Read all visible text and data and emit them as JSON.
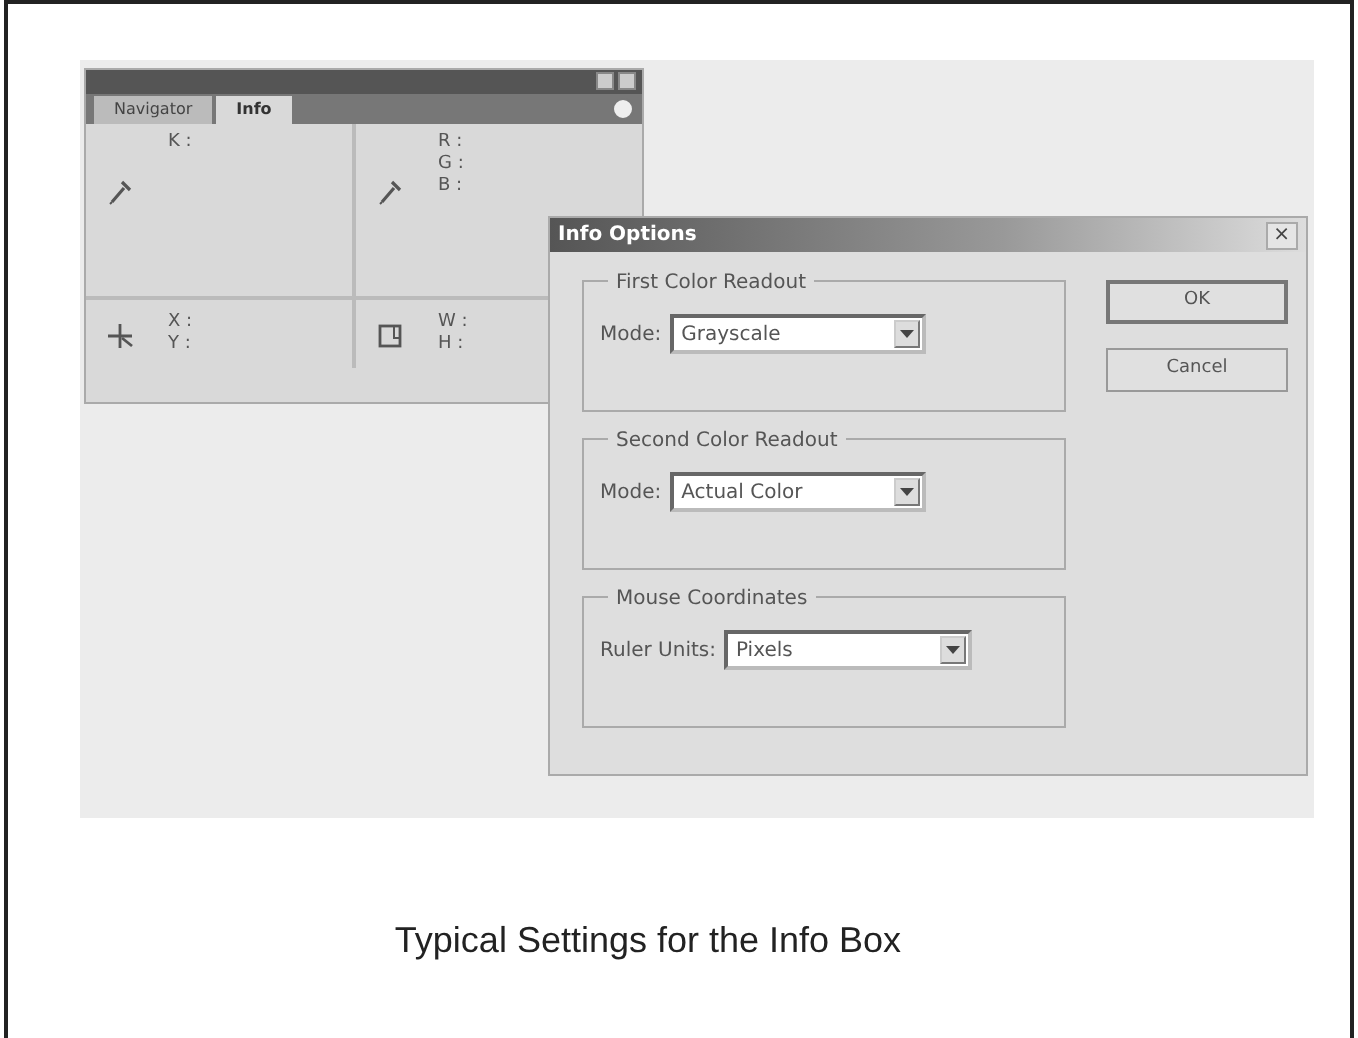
{
  "palette": {
    "tabs": [
      {
        "label": "Navigator",
        "selected": false
      },
      {
        "label": "Info",
        "selected": true
      }
    ],
    "sections": [
      {
        "kind": "eyedropper",
        "lines": [
          "K :"
        ]
      },
      {
        "kind": "eyedropper",
        "lines": [
          "R :",
          "G :",
          "B :"
        ]
      },
      {
        "kind": "crosshair",
        "lines": [
          "X :",
          "Y :"
        ]
      },
      {
        "kind": "rectangle",
        "lines": [
          "W :",
          "H :"
        ]
      }
    ]
  },
  "dialog": {
    "title": "Info Options",
    "close": "×",
    "groups": [
      {
        "title": "First Color Readout",
        "label": "Mode:",
        "value": "Grayscale"
      },
      {
        "title": "Second Color Readout",
        "label": "Mode:",
        "value": "Actual Color"
      },
      {
        "title": "Mouse Coordinates",
        "label": "Ruler Units:",
        "value": "Pixels"
      }
    ],
    "buttons": [
      {
        "label": "OK",
        "default": true
      },
      {
        "label": "Cancel",
        "default": false
      }
    ]
  },
  "caption": "Typical Settings for the Info Box"
}
